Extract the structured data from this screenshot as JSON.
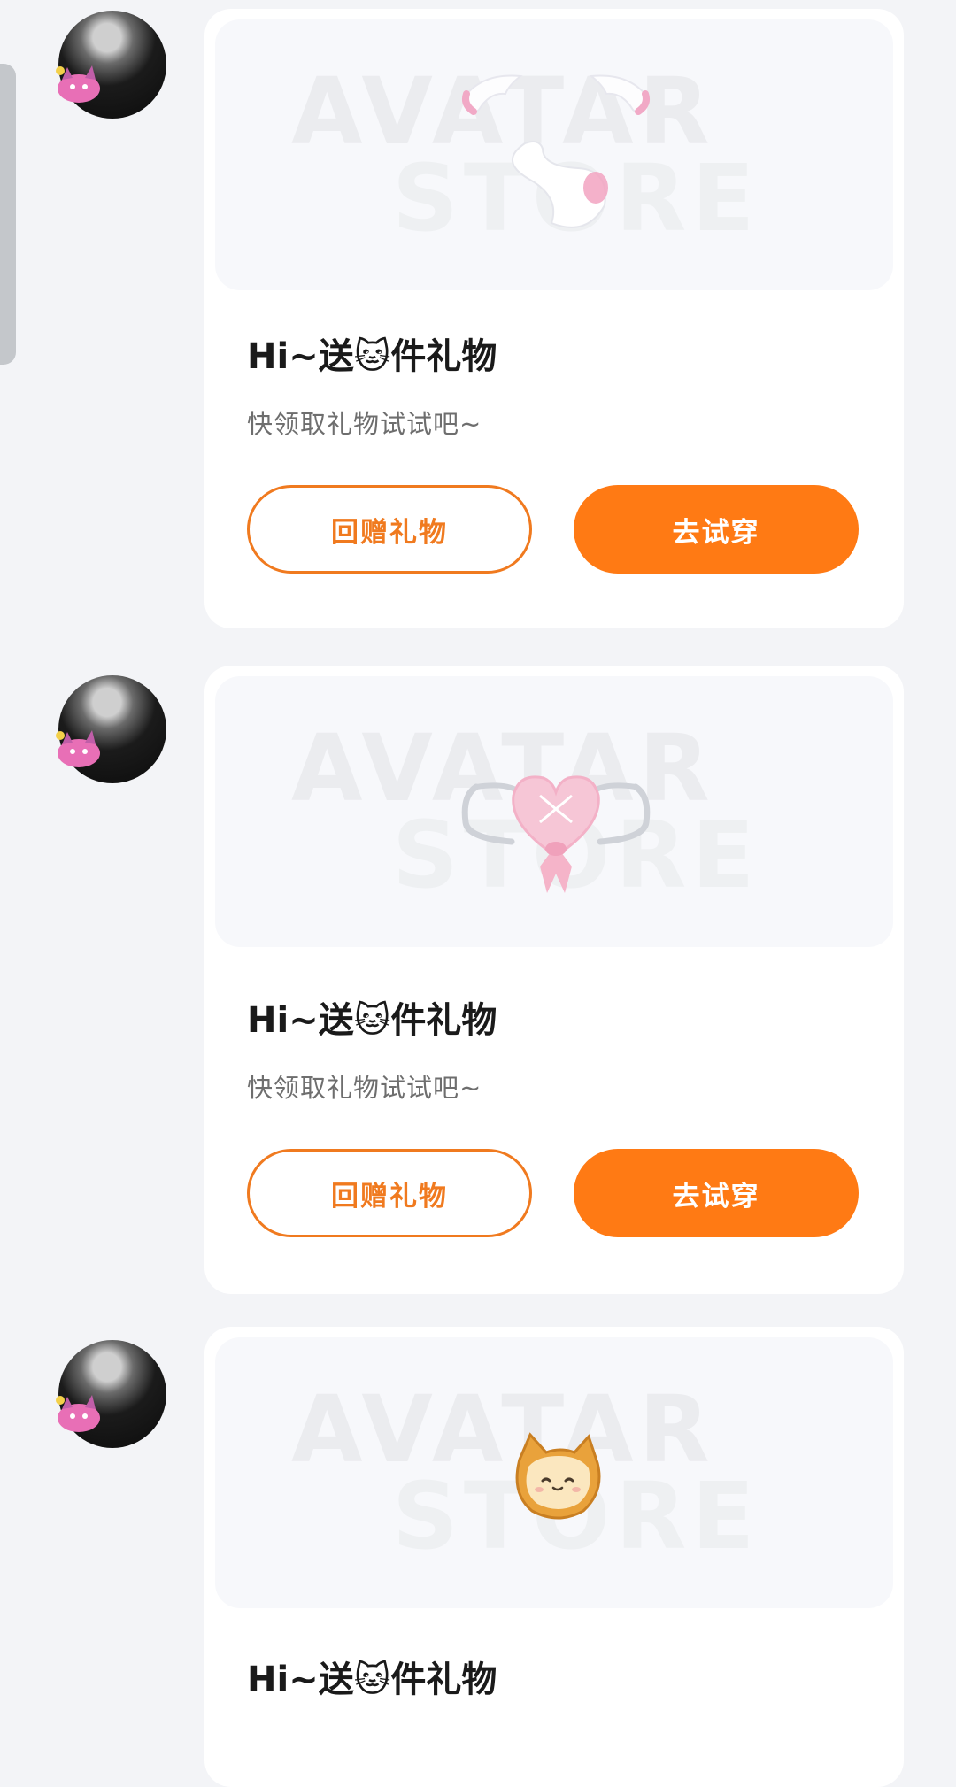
{
  "messages": [
    {
      "title": "Hi~送🐱件礼物",
      "subtitle": "快领取礼物试试吧~",
      "return_gift_label": "回赠礼物",
      "try_on_label": "去试穿",
      "watermark_line1": "AVATAR",
      "watermark_line2": "STORE",
      "item_icon": "angel-wings-and-tail-icon"
    },
    {
      "title": "Hi~送🐱件礼物",
      "subtitle": "快领取礼物试试吧~",
      "return_gift_label": "回赠礼物",
      "try_on_label": "去试穿",
      "watermark_line1": "AVATAR",
      "watermark_line2": "STORE",
      "item_icon": "heart-bow-mask-icon"
    },
    {
      "title": "Hi~送🐱件礼物",
      "watermark_line1": "AVATAR",
      "watermark_line2": "STORE",
      "item_icon": "cat-bread-icon"
    }
  ],
  "colors": {
    "accent": "#ff7a14",
    "background": "#f3f4f7",
    "card": "#ffffff"
  }
}
